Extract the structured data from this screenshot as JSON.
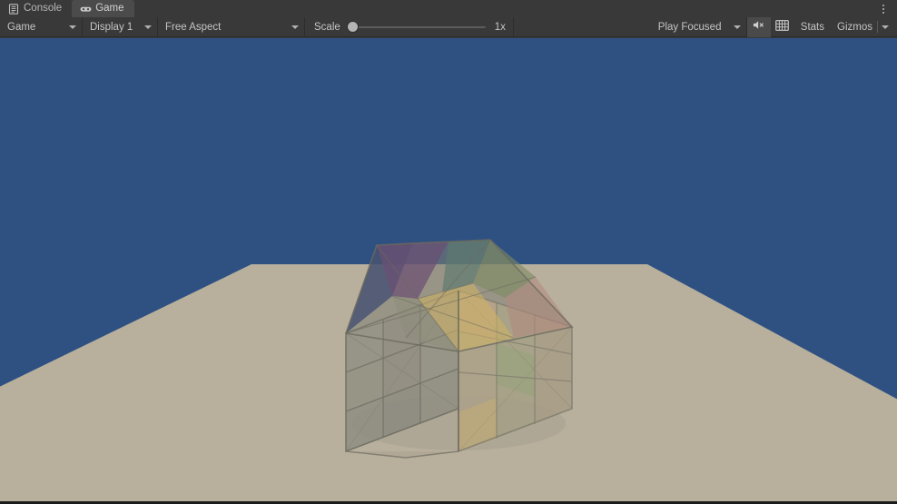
{
  "window": {
    "title": "Game",
    "kebab_icon": "kebab-menu-icon"
  },
  "tabs": [
    {
      "label": "Console",
      "icon": "console-icon",
      "active": false
    },
    {
      "label": "Game",
      "icon": "gamepad-icon",
      "active": true
    }
  ],
  "toolbar": {
    "view_mode": {
      "label": "Game",
      "icon": "chevron-down-icon"
    },
    "display": {
      "label": "Display 1",
      "icon": "chevron-down-icon"
    },
    "aspect": {
      "label": "Free Aspect",
      "icon": "chevron-down-icon"
    },
    "scale": {
      "label": "Scale",
      "value_label": "1x",
      "value": 1,
      "min": 1,
      "max": 5,
      "knob_percent": 0
    },
    "play_mode": {
      "label": "Play Focused",
      "icon": "chevron-down-icon"
    },
    "mute_audio": {
      "icon": "mute-audio-icon",
      "active": true
    },
    "aspect_grid": {
      "icon": "grid-icon",
      "active": false
    },
    "stats": {
      "label": "Stats"
    },
    "gizmos": {
      "label": "Gizmos",
      "icon": "chevron-down-icon"
    }
  },
  "scene": {
    "sky_color": "#2f5182",
    "ground_color": "#b8b09d",
    "ground_shadow_color": "#a9a291",
    "description": "3x3x3 translucent rubiks-style cube resting on a ground plane",
    "cube": {
      "top_face_tiles": [
        "#3c4a70",
        "#6b4f73",
        "#5d7b6e",
        "#7d8a63",
        "#8a7d72",
        "#c9b06a",
        "#b99a86"
      ],
      "left_face_tint": "#8e8d82",
      "right_face_tint": "#a59a83",
      "edge_color": "#7d7a6e"
    }
  }
}
